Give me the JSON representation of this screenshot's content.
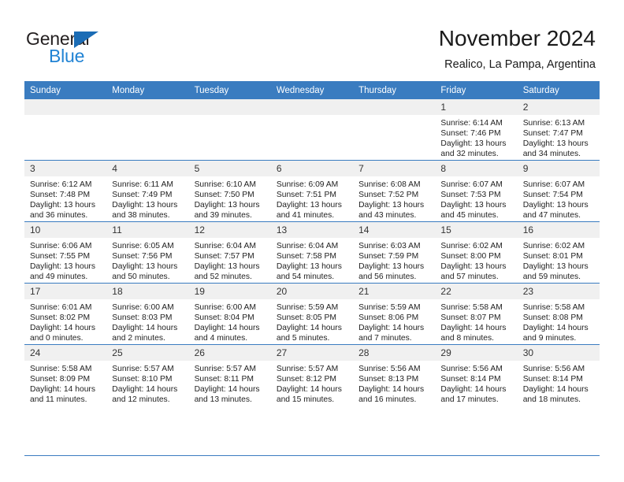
{
  "brand": {
    "name_part1": "General",
    "name_part2": "Blue",
    "accent_color": "#2183d4",
    "triangle_color": "#1b6cb5"
  },
  "header": {
    "title": "November 2024",
    "subtitle": "Realico, La Pampa, Argentina"
  },
  "theme": {
    "header_row_bg": "#3a7cc0",
    "daynum_bg": "#f0f0f0",
    "grid_line": "#3a7cc0"
  },
  "weekday_headers": [
    "Sunday",
    "Monday",
    "Tuesday",
    "Wednesday",
    "Thursday",
    "Friday",
    "Saturday"
  ],
  "weeks": [
    [
      {
        "day": "",
        "sunrise": "",
        "sunset": "",
        "daylight_line1": "",
        "daylight_line2": ""
      },
      {
        "day": "",
        "sunrise": "",
        "sunset": "",
        "daylight_line1": "",
        "daylight_line2": ""
      },
      {
        "day": "",
        "sunrise": "",
        "sunset": "",
        "daylight_line1": "",
        "daylight_line2": ""
      },
      {
        "day": "",
        "sunrise": "",
        "sunset": "",
        "daylight_line1": "",
        "daylight_line2": ""
      },
      {
        "day": "",
        "sunrise": "",
        "sunset": "",
        "daylight_line1": "",
        "daylight_line2": ""
      },
      {
        "day": "1",
        "sunrise": "Sunrise: 6:14 AM",
        "sunset": "Sunset: 7:46 PM",
        "daylight_line1": "Daylight: 13 hours",
        "daylight_line2": "and 32 minutes."
      },
      {
        "day": "2",
        "sunrise": "Sunrise: 6:13 AM",
        "sunset": "Sunset: 7:47 PM",
        "daylight_line1": "Daylight: 13 hours",
        "daylight_line2": "and 34 minutes."
      }
    ],
    [
      {
        "day": "3",
        "sunrise": "Sunrise: 6:12 AM",
        "sunset": "Sunset: 7:48 PM",
        "daylight_line1": "Daylight: 13 hours",
        "daylight_line2": "and 36 minutes."
      },
      {
        "day": "4",
        "sunrise": "Sunrise: 6:11 AM",
        "sunset": "Sunset: 7:49 PM",
        "daylight_line1": "Daylight: 13 hours",
        "daylight_line2": "and 38 minutes."
      },
      {
        "day": "5",
        "sunrise": "Sunrise: 6:10 AM",
        "sunset": "Sunset: 7:50 PM",
        "daylight_line1": "Daylight: 13 hours",
        "daylight_line2": "and 39 minutes."
      },
      {
        "day": "6",
        "sunrise": "Sunrise: 6:09 AM",
        "sunset": "Sunset: 7:51 PM",
        "daylight_line1": "Daylight: 13 hours",
        "daylight_line2": "and 41 minutes."
      },
      {
        "day": "7",
        "sunrise": "Sunrise: 6:08 AM",
        "sunset": "Sunset: 7:52 PM",
        "daylight_line1": "Daylight: 13 hours",
        "daylight_line2": "and 43 minutes."
      },
      {
        "day": "8",
        "sunrise": "Sunrise: 6:07 AM",
        "sunset": "Sunset: 7:53 PM",
        "daylight_line1": "Daylight: 13 hours",
        "daylight_line2": "and 45 minutes."
      },
      {
        "day": "9",
        "sunrise": "Sunrise: 6:07 AM",
        "sunset": "Sunset: 7:54 PM",
        "daylight_line1": "Daylight: 13 hours",
        "daylight_line2": "and 47 minutes."
      }
    ],
    [
      {
        "day": "10",
        "sunrise": "Sunrise: 6:06 AM",
        "sunset": "Sunset: 7:55 PM",
        "daylight_line1": "Daylight: 13 hours",
        "daylight_line2": "and 49 minutes."
      },
      {
        "day": "11",
        "sunrise": "Sunrise: 6:05 AM",
        "sunset": "Sunset: 7:56 PM",
        "daylight_line1": "Daylight: 13 hours",
        "daylight_line2": "and 50 minutes."
      },
      {
        "day": "12",
        "sunrise": "Sunrise: 6:04 AM",
        "sunset": "Sunset: 7:57 PM",
        "daylight_line1": "Daylight: 13 hours",
        "daylight_line2": "and 52 minutes."
      },
      {
        "day": "13",
        "sunrise": "Sunrise: 6:04 AM",
        "sunset": "Sunset: 7:58 PM",
        "daylight_line1": "Daylight: 13 hours",
        "daylight_line2": "and 54 minutes."
      },
      {
        "day": "14",
        "sunrise": "Sunrise: 6:03 AM",
        "sunset": "Sunset: 7:59 PM",
        "daylight_line1": "Daylight: 13 hours",
        "daylight_line2": "and 56 minutes."
      },
      {
        "day": "15",
        "sunrise": "Sunrise: 6:02 AM",
        "sunset": "Sunset: 8:00 PM",
        "daylight_line1": "Daylight: 13 hours",
        "daylight_line2": "and 57 minutes."
      },
      {
        "day": "16",
        "sunrise": "Sunrise: 6:02 AM",
        "sunset": "Sunset: 8:01 PM",
        "daylight_line1": "Daylight: 13 hours",
        "daylight_line2": "and 59 minutes."
      }
    ],
    [
      {
        "day": "17",
        "sunrise": "Sunrise: 6:01 AM",
        "sunset": "Sunset: 8:02 PM",
        "daylight_line1": "Daylight: 14 hours",
        "daylight_line2": "and 0 minutes."
      },
      {
        "day": "18",
        "sunrise": "Sunrise: 6:00 AM",
        "sunset": "Sunset: 8:03 PM",
        "daylight_line1": "Daylight: 14 hours",
        "daylight_line2": "and 2 minutes."
      },
      {
        "day": "19",
        "sunrise": "Sunrise: 6:00 AM",
        "sunset": "Sunset: 8:04 PM",
        "daylight_line1": "Daylight: 14 hours",
        "daylight_line2": "and 4 minutes."
      },
      {
        "day": "20",
        "sunrise": "Sunrise: 5:59 AM",
        "sunset": "Sunset: 8:05 PM",
        "daylight_line1": "Daylight: 14 hours",
        "daylight_line2": "and 5 minutes."
      },
      {
        "day": "21",
        "sunrise": "Sunrise: 5:59 AM",
        "sunset": "Sunset: 8:06 PM",
        "daylight_line1": "Daylight: 14 hours",
        "daylight_line2": "and 7 minutes."
      },
      {
        "day": "22",
        "sunrise": "Sunrise: 5:58 AM",
        "sunset": "Sunset: 8:07 PM",
        "daylight_line1": "Daylight: 14 hours",
        "daylight_line2": "and 8 minutes."
      },
      {
        "day": "23",
        "sunrise": "Sunrise: 5:58 AM",
        "sunset": "Sunset: 8:08 PM",
        "daylight_line1": "Daylight: 14 hours",
        "daylight_line2": "and 9 minutes."
      }
    ],
    [
      {
        "day": "24",
        "sunrise": "Sunrise: 5:58 AM",
        "sunset": "Sunset: 8:09 PM",
        "daylight_line1": "Daylight: 14 hours",
        "daylight_line2": "and 11 minutes."
      },
      {
        "day": "25",
        "sunrise": "Sunrise: 5:57 AM",
        "sunset": "Sunset: 8:10 PM",
        "daylight_line1": "Daylight: 14 hours",
        "daylight_line2": "and 12 minutes."
      },
      {
        "day": "26",
        "sunrise": "Sunrise: 5:57 AM",
        "sunset": "Sunset: 8:11 PM",
        "daylight_line1": "Daylight: 14 hours",
        "daylight_line2": "and 13 minutes."
      },
      {
        "day": "27",
        "sunrise": "Sunrise: 5:57 AM",
        "sunset": "Sunset: 8:12 PM",
        "daylight_line1": "Daylight: 14 hours",
        "daylight_line2": "and 15 minutes."
      },
      {
        "day": "28",
        "sunrise": "Sunrise: 5:56 AM",
        "sunset": "Sunset: 8:13 PM",
        "daylight_line1": "Daylight: 14 hours",
        "daylight_line2": "and 16 minutes."
      },
      {
        "day": "29",
        "sunrise": "Sunrise: 5:56 AM",
        "sunset": "Sunset: 8:14 PM",
        "daylight_line1": "Daylight: 14 hours",
        "daylight_line2": "and 17 minutes."
      },
      {
        "day": "30",
        "sunrise": "Sunrise: 5:56 AM",
        "sunset": "Sunset: 8:14 PM",
        "daylight_line1": "Daylight: 14 hours",
        "daylight_line2": "and 18 minutes."
      }
    ]
  ]
}
